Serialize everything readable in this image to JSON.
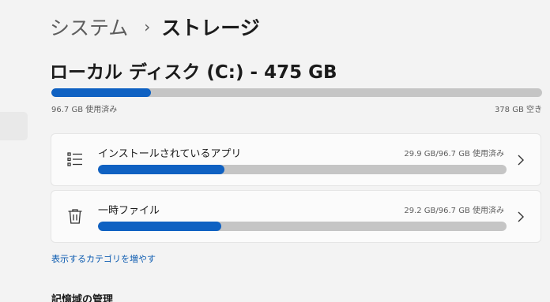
{
  "breadcrumb": {
    "parent": "システム",
    "separator": "›",
    "current": "ストレージ"
  },
  "drive": {
    "title": "ローカル ディスク (C:) - 475 GB",
    "used_label": "96.7 GB 使用済み",
    "free_label": "378 GB 空き",
    "used_fraction": 0.2036
  },
  "categories": [
    {
      "label": "インストールされているアプリ",
      "usage": "29.9 GB/96.7 GB 使用済み",
      "fraction": 0.3092,
      "icon": "list-icon"
    },
    {
      "label": "一時ファイル",
      "usage": "29.2 GB/96.7 GB 使用済み",
      "fraction": 0.302,
      "icon": "trash-icon"
    }
  ],
  "more_link": "表示するカテゴリを増やす",
  "section_heading": "記憶域の管理",
  "colors": {
    "accent": "#0f61c2",
    "track": "#c5c5c5",
    "link": "#0a5ab0"
  }
}
